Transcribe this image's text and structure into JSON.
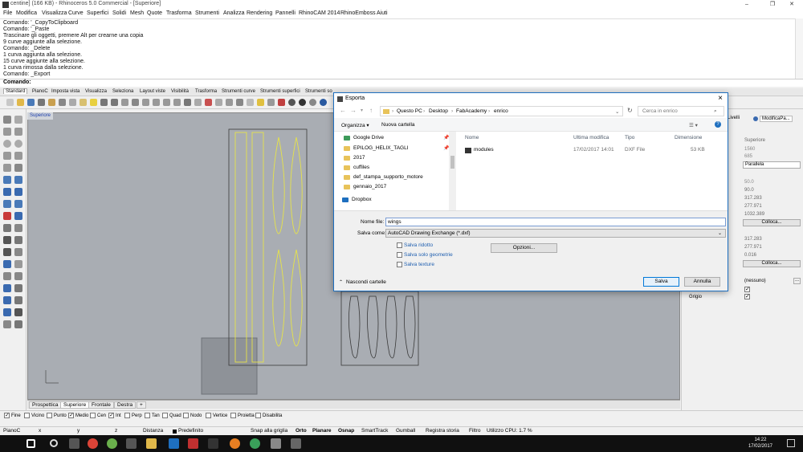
{
  "window": {
    "title": "centine] (166 KB) - Rhinoceros 5.0 Commercial - [Superiore]",
    "controls": [
      "–",
      "❐",
      "✕"
    ]
  },
  "menu": [
    "File",
    "Modifica",
    "Visualizza",
    "Curve",
    "Superfici",
    "Solidi",
    "Mesh",
    "Quote",
    "Trasforma",
    "Strumenti",
    "Analizza",
    "Rendering",
    "Pannelli",
    "RhinoCAM 2014",
    "RhinoEmboss",
    "Aiuti"
  ],
  "command_history": [
    "Comando: '_CopyToClipboard",
    "Comando: '_Paste",
    "Trascinare gli oggetti, premere Alt per crearne una copia",
    "9 curve aggiunte alla selezione.",
    "Comando: _Delete",
    "1 curva aggiunta alla selezione.",
    "15 curve aggiunte alla selezione.",
    "1 curva rimossa dalla selezione.",
    "Comando: _Export"
  ],
  "command_prompt": "Comando:",
  "toolbar_tabs": [
    "Standard",
    "PianoC",
    "Imposta vista",
    "Visualizza",
    "Seleziona",
    "Layout viste",
    "Visibilità",
    "Trasforma",
    "Strumenti curve",
    "Strumenti superfici",
    "Strumenti so"
  ],
  "viewport": {
    "label": "Superiore",
    "tabs": [
      "Prospettica",
      "Superiore",
      "Frontale",
      "Destra",
      "+"
    ],
    "active_tab": "Superiore"
  },
  "osnap": [
    {
      "label": "Fine",
      "checked": true
    },
    {
      "label": "Vicino",
      "checked": false
    },
    {
      "label": "Punto",
      "checked": false
    },
    {
      "label": "Medio",
      "checked": true
    },
    {
      "label": "Cen",
      "checked": false
    },
    {
      "label": "Int",
      "checked": true
    },
    {
      "label": "Perp",
      "checked": false
    },
    {
      "label": "Tan",
      "checked": false
    },
    {
      "label": "Quad",
      "checked": false
    },
    {
      "label": "Nodo",
      "checked": false
    },
    {
      "label": "Vertice",
      "checked": false
    },
    {
      "label": "Proietta",
      "checked": false
    },
    {
      "label": "Disabilita",
      "checked": false
    }
  ],
  "status": {
    "cplane": "PianoC",
    "x": "x",
    "y": "y",
    "z": "z",
    "distance": "Distanza",
    "layer": "Predefinito",
    "items": [
      "Snap alla griglia",
      "Orto",
      "Planare",
      "Osnap",
      "SmartTrack",
      "Gumball",
      "Registra storia",
      "Filtro",
      "Utilizzo CPU: 1.7 %"
    ],
    "bold_items": [
      "Orto",
      "Planare",
      "Osnap"
    ]
  },
  "taskbar": {
    "time": "14:22",
    "date": "17/02/2017"
  },
  "right_panel": {
    "tabs": [
      "Livelli",
      "ModificaPa..."
    ],
    "values": [
      "Superiore",
      "1560",
      "685",
      "Parallela",
      "50.0",
      "90.0",
      "317.283",
      "277.971",
      "1032.389",
      "317.283",
      "277.971",
      "0.016"
    ],
    "buttons": [
      "Colloca...",
      "Colloca..."
    ],
    "none_value": "(nessuno)",
    "grigio": "Grigio"
  },
  "dialog": {
    "title": "Esporta",
    "breadcrumb": [
      "Questo PC",
      "Desktop",
      "FabAcademy",
      "enrico"
    ],
    "search_placeholder": "Cerca in enrico",
    "organize": "Organizza ▾",
    "new_folder": "Nuova cartella",
    "nav_items": [
      {
        "label": "Google Drive",
        "pinned": true,
        "icon": "google-drive-icon"
      },
      {
        "label": "EPILOG_HELIX_TAGLI",
        "pinned": true,
        "icon": "folder-icon"
      },
      {
        "label": "2017",
        "pinned": false,
        "icon": "folder-icon"
      },
      {
        "label": "cuffiles",
        "pinned": false,
        "icon": "folder-icon"
      },
      {
        "label": "def_stampa_supporto_motore",
        "pinned": false,
        "icon": "folder-icon"
      },
      {
        "label": "gennaio_2017",
        "pinned": false,
        "icon": "folder-icon"
      },
      {
        "label": "Dropbox",
        "pinned": false,
        "icon": "dropbox-icon"
      }
    ],
    "columns": [
      "Nome",
      "Ultima modifica",
      "Tipo",
      "Dimensione"
    ],
    "files": [
      {
        "name": "modules",
        "modified": "17/02/2017 14:01",
        "type": "DXF File",
        "size": "53 KB"
      }
    ],
    "filename_label": "Nome file:",
    "filename_value": "wings",
    "save_as_label": "Salva come:",
    "save_as_value": "AutoCAD Drawing Exchange (*.dxf)",
    "options": [
      {
        "label": "Salva ridotto",
        "checked": false
      },
      {
        "label": "Salva solo geometrie",
        "checked": false
      },
      {
        "label": "Salva texture",
        "checked": false
      }
    ],
    "options_button": "Opzioni...",
    "hide_folders": "Nascondi cartelle",
    "save_button": "Salva",
    "cancel_button": "Annulla"
  },
  "colors": {
    "accent": "#0078d7",
    "viewport_bg": "#a9adb3",
    "selected_curve": "#e6e34a",
    "curve": "#3a3a3a"
  }
}
